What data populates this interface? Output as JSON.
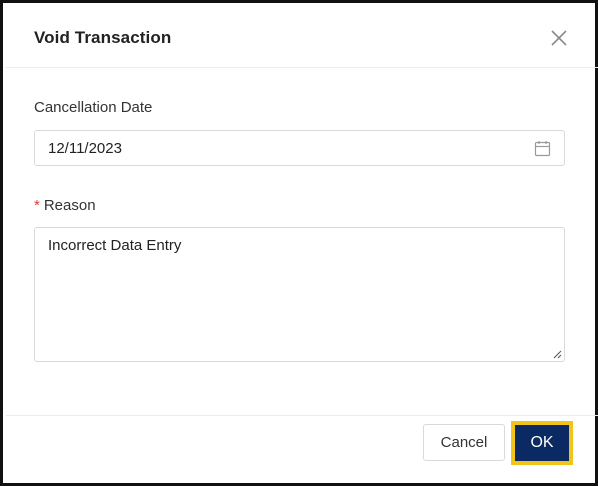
{
  "dialog": {
    "title": "Void Transaction",
    "close_icon": "close-icon"
  },
  "form": {
    "cancellation_date": {
      "label": "Cancellation Date",
      "value": "12/11/2023",
      "icon": "calendar-icon"
    },
    "reason": {
      "required_marker": "*",
      "label": "Reason",
      "value": "Incorrect Data Entry"
    }
  },
  "footer": {
    "cancel_label": "Cancel",
    "ok_label": "OK"
  },
  "colors": {
    "primary": "#0b2a63",
    "highlight": "#f2c318",
    "required": "#e53935"
  }
}
